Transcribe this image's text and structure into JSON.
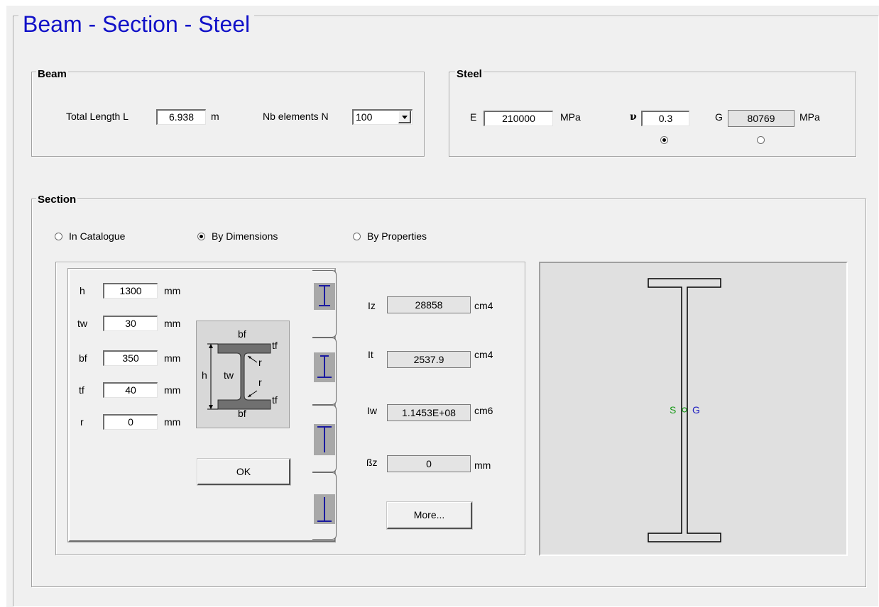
{
  "title": "Beam - Section - Steel",
  "beam": {
    "legend": "Beam",
    "total_length_label": "Total Length  L",
    "total_length_value": "6.938",
    "total_length_unit": "m",
    "nb_elements_label": "Nb elements  N",
    "nb_elements_value": "100"
  },
  "steel": {
    "legend": "Steel",
    "e_label": "E",
    "e_value": "210000",
    "e_unit": "MPa",
    "nu_label": "ν",
    "nu_value": "0.3",
    "g_label": "G",
    "g_value": "80769",
    "g_unit": "MPa"
  },
  "section": {
    "legend": "Section",
    "modes": [
      {
        "label": "In Catalogue",
        "selected": false
      },
      {
        "label": "By Dimensions",
        "selected": true
      },
      {
        "label": "By Properties",
        "selected": false
      }
    ],
    "dims": [
      {
        "label": "h",
        "value": "1300",
        "unit": "mm"
      },
      {
        "label": "tw",
        "value": "30",
        "unit": "mm"
      },
      {
        "label": "bf",
        "value": "350",
        "unit": "mm"
      },
      {
        "label": "tf",
        "value": "40",
        "unit": "mm"
      },
      {
        "label": "r",
        "value": "0",
        "unit": "mm"
      }
    ],
    "diagram_labels": {
      "bf_top": "bf",
      "tf_top": "tf",
      "h": "h",
      "tw": "tw",
      "r_top": "r",
      "r_bot": "r",
      "tf_bot": "tf",
      "bf_bot": "bf"
    },
    "ok_label": "OK",
    "properties": [
      {
        "label": "Iz",
        "value": "28858",
        "unit": "cm4"
      },
      {
        "label": "It",
        "value": "2537.9",
        "unit": "cm4"
      },
      {
        "label": "Iw",
        "value": "1.1453E+08",
        "unit": "cm6"
      },
      {
        "label": "ßz",
        "value": "0",
        "unit": "mm"
      }
    ],
    "more_label": "More...",
    "preview": {
      "s_label": "S",
      "g_label": "G"
    }
  },
  "colors": {
    "title": "#1010c8",
    "shape_icon": "#1a1aa0",
    "s_marker": "#1a9a1a",
    "g_marker": "#2020c0"
  }
}
